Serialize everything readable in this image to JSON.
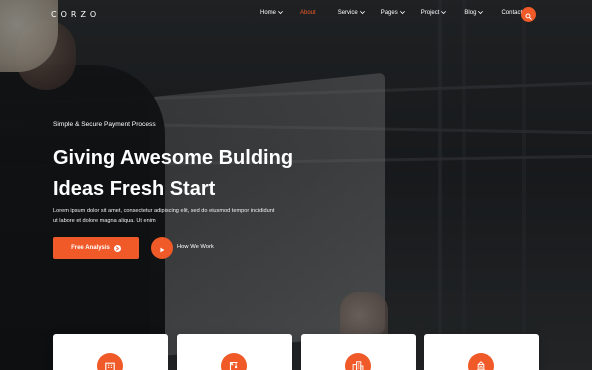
{
  "brand": {
    "logo_text": "CORZO"
  },
  "nav": {
    "items": [
      {
        "label": "Home",
        "has_dropdown": true,
        "active": false
      },
      {
        "label": "About",
        "has_dropdown": false,
        "active": true
      },
      {
        "label": "Service",
        "has_dropdown": true,
        "active": false
      },
      {
        "label": "Pages",
        "has_dropdown": true,
        "active": false
      },
      {
        "label": "Project",
        "has_dropdown": true,
        "active": false
      },
      {
        "label": "Blog",
        "has_dropdown": true,
        "active": false
      },
      {
        "label": "Contact",
        "has_dropdown": false,
        "active": false
      }
    ],
    "search_icon": "search-icon"
  },
  "hero": {
    "kicker": "Simple & Secure Payment Process",
    "title_line_1": "Giving Awesome Bulding",
    "title_line_2": "Ideas Fresh Start",
    "description_line_1": "Lorem ipsum dolor sit amet, consectetur adipiscing elit, sed do eiusmod tempor incididunt",
    "description_line_2": "ut labore et dolore magna aliqua. Ut enim",
    "primary_button_label": "Free Analysis",
    "video_link_label": "How We Work"
  },
  "feature_cards": [
    {
      "icon": "building-icon"
    },
    {
      "icon": "crane-icon"
    },
    {
      "icon": "city-icon"
    },
    {
      "icon": "construction-icon"
    }
  ],
  "colors": {
    "accent": "#f05a28",
    "active_nav": "#f05a28",
    "text_light": "#ffffff",
    "card_bg": "#ffffff"
  }
}
